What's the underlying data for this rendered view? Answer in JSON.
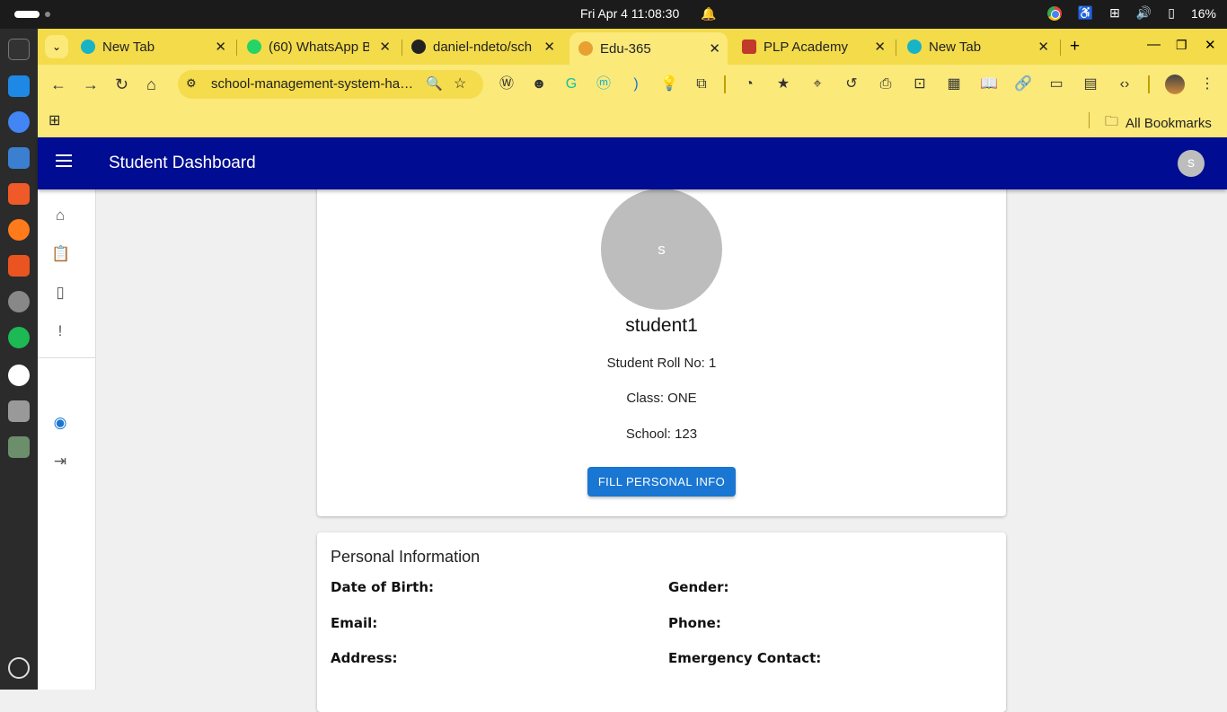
{
  "os": {
    "datetime": "Fri Apr 4  11:08:30",
    "battery": "16%"
  },
  "browser": {
    "tabs": [
      {
        "title": "New Tab",
        "active": false
      },
      {
        "title": "(60) WhatsApp B",
        "active": false
      },
      {
        "title": "daniel-ndeto/sch",
        "active": false
      },
      {
        "title": "Edu-365",
        "active": true
      },
      {
        "title": "PLP Academy",
        "active": false
      },
      {
        "title": "New Tab",
        "active": false
      }
    ],
    "url": "school-management-system-haze...",
    "bookmarks_label": "All Bookmarks"
  },
  "app": {
    "title": "Student Dashboard",
    "avatar_initial": "s"
  },
  "profile": {
    "avatar_initial": "s",
    "name": "student1",
    "roll": "Student Roll No: 1",
    "class": "Class: ONE",
    "school": "School: 123",
    "button": "FILL PERSONAL INFO"
  },
  "personal": {
    "heading": "Personal Information",
    "dob": "Date of Birth:",
    "gender": "Gender:",
    "email": "Email:",
    "phone": "Phone:",
    "address": "Address:",
    "emergency": "Emergency Contact:"
  },
  "colors": {
    "appbar": "#000c91",
    "button": "#1976d2",
    "browser": "#fbe97a"
  }
}
